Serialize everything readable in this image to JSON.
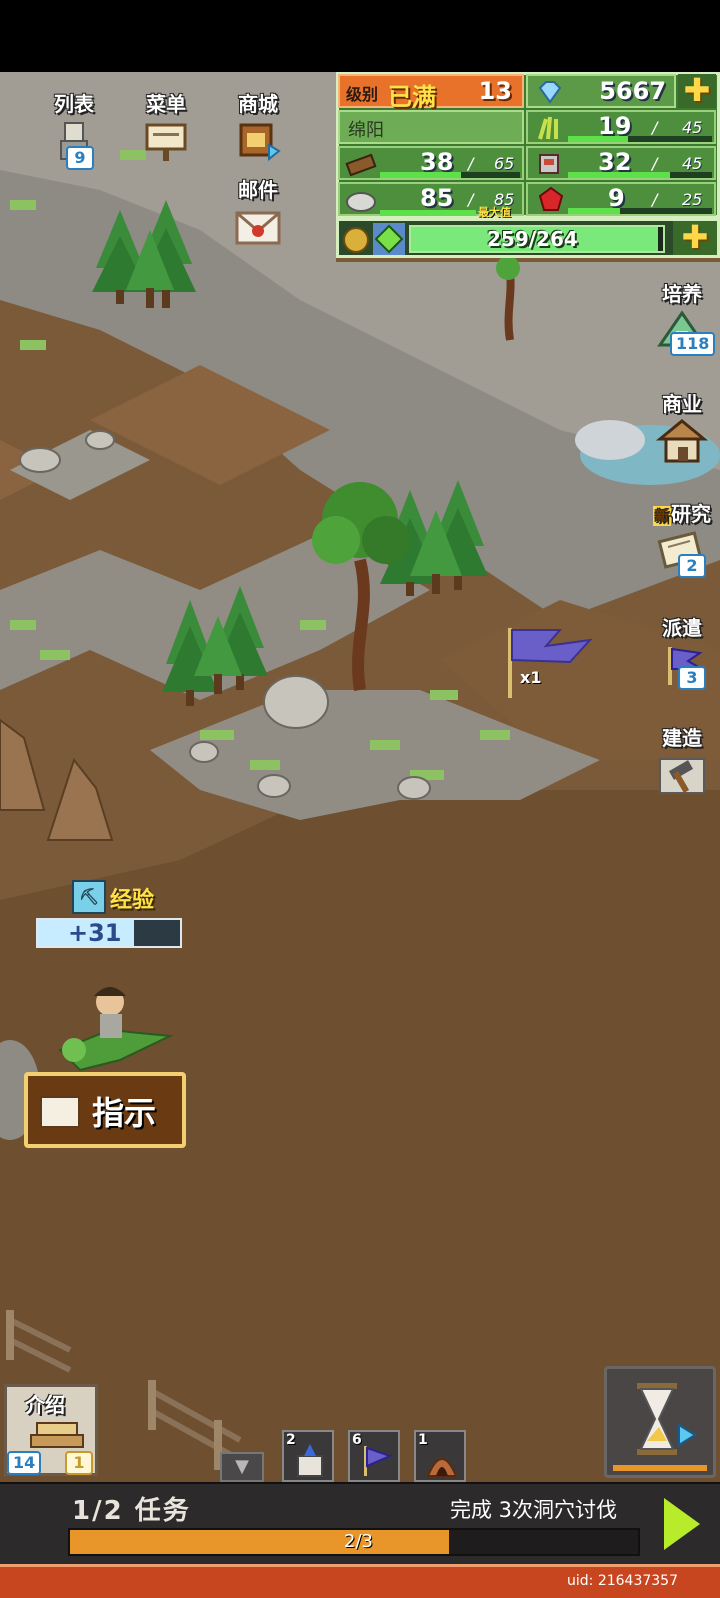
{
  "menu": {
    "list_label": "列表",
    "list_badge": "9",
    "menu_label": "菜单",
    "shop_label": "商城",
    "mail_label": "邮件"
  },
  "resources": {
    "level_label": "级别",
    "level_status": "已满",
    "level_value": "13",
    "gems": "5667",
    "town": "绵阳",
    "food": {
      "value": "19",
      "max": "45",
      "fill": 0.42
    },
    "wood": {
      "value": "38",
      "max": "65",
      "fill": 0.58
    },
    "stone": {
      "value": "85",
      "max": "85",
      "max_tag": "最大值",
      "fill": 1.0
    },
    "armor": {
      "value": "32",
      "max": "45",
      "fill": 0.71
    },
    "ruby": {
      "value": "9",
      "max": "25",
      "fill": 0.36
    },
    "energy": {
      "text": "259/264",
      "fill": 0.98
    }
  },
  "right_menu": {
    "train_label": "培养",
    "train_badge": "118",
    "business_label": "商业",
    "research_new": "新",
    "research_label": "研究",
    "research_badge": "2",
    "dispatch_label": "派遣",
    "dispatch_badge": "3",
    "build_label": "建造"
  },
  "map": {
    "flag_count": "x1",
    "exp_label": "经验",
    "exp_gain": "+31",
    "guide_label": "指示"
  },
  "bottom": {
    "intro_label": "介绍",
    "intro_badge_left": "14",
    "intro_badge_right": "1",
    "slot_castle": "2",
    "slot_flag": "6",
    "slot_cave": "1",
    "task_label": "1/2 任务",
    "task_desc": "完成 3次洞穴讨伐",
    "task_progress": "2/3",
    "task_fill": 0.667,
    "uid": "uid: 216437357"
  },
  "colors": {
    "dirt": "#7a5a38",
    "rock": "#8c8a84",
    "panel_green": "#4e8f3e",
    "accent_yellow": "#ffd84a",
    "progress_orange": "#e8962a"
  }
}
